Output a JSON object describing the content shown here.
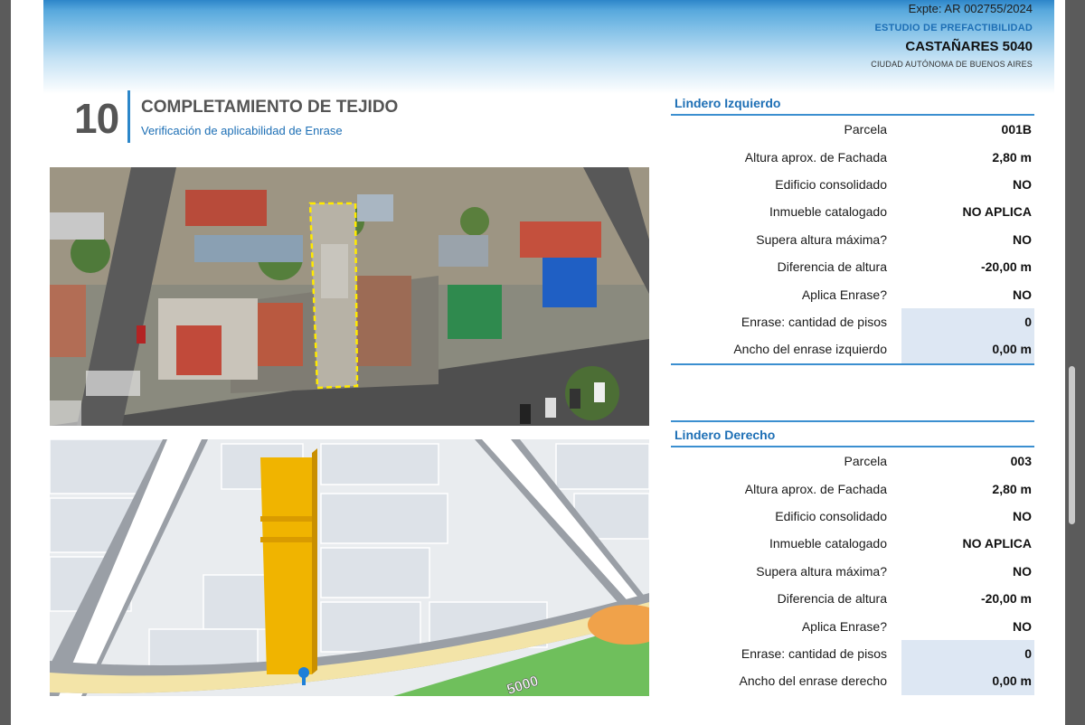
{
  "header": {
    "expte": "Expte: AR 002755/2024",
    "estudio": "ESTUDIO DE PREFACTIBILIDAD",
    "address": "CASTAÑARES 5040",
    "city": "CIUDAD AUTÓNOMA DE BUENOS AIRES"
  },
  "section": {
    "number": "10",
    "title": "COMPLETAMIENTO DE TEJIDO",
    "subtitle": "Verificación de aplicabilidad de Enrase"
  },
  "map3d": {
    "street_label": "5000"
  },
  "lindero_izquierdo": {
    "title": "Lindero Izquierdo",
    "rows": [
      {
        "label": "Parcela",
        "value": "001B"
      },
      {
        "label": "Altura aprox. de Fachada",
        "value": "2,80 m"
      },
      {
        "label": "Edificio consolidado",
        "value": "NO"
      },
      {
        "label": "Inmueble catalogado",
        "value": "NO APLICA"
      },
      {
        "label": "Supera altura máxima?",
        "value": "NO"
      },
      {
        "label": "Diferencia de altura",
        "value": "-20,00 m"
      },
      {
        "label": "Aplica Enrase?",
        "value": "NO"
      },
      {
        "label": "Enrase: cantidad de pisos",
        "value": "0"
      },
      {
        "label": "Ancho del enrase izquierdo",
        "value": "0,00 m"
      }
    ]
  },
  "lindero_derecho": {
    "title": "Lindero Derecho",
    "rows": [
      {
        "label": "Parcela",
        "value": "003"
      },
      {
        "label": "Altura aprox. de Fachada",
        "value": "2,80 m"
      },
      {
        "label": "Edificio consolidado",
        "value": "NO"
      },
      {
        "label": "Inmueble catalogado",
        "value": "NO APLICA"
      },
      {
        "label": "Supera altura máxima?",
        "value": "NO"
      },
      {
        "label": "Diferencia de altura",
        "value": "-20,00 m"
      },
      {
        "label": "Aplica Enrase?",
        "value": "NO"
      },
      {
        "label": "Enrase: cantidad de pisos",
        "value": "0"
      },
      {
        "label": "Ancho del enrase derecho",
        "value": "0,00 m"
      }
    ]
  }
}
